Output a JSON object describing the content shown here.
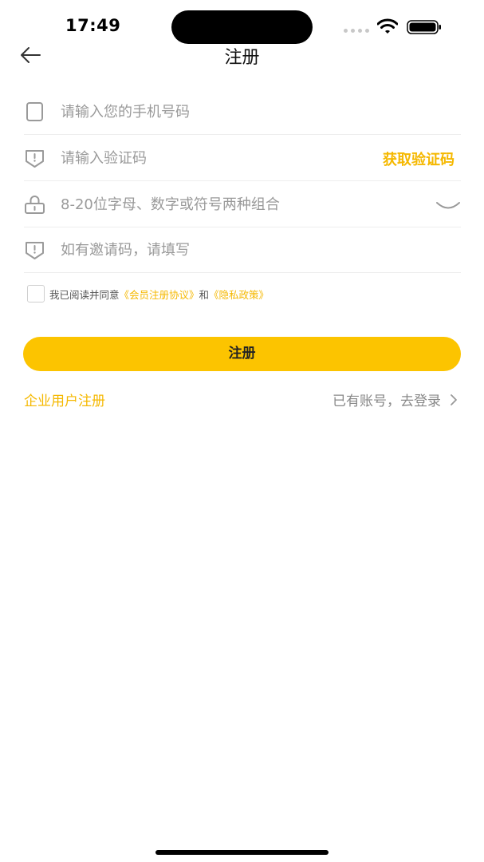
{
  "status_bar": {
    "time": "17:49"
  },
  "nav": {
    "title": "注册"
  },
  "form": {
    "phone_placeholder": "请输入您的手机号码",
    "code_placeholder": "请输入验证码",
    "get_code_label": "获取验证码",
    "password_placeholder": "8-20位字母、数字或符号两种组合",
    "invite_placeholder": "如有邀请码，请填写"
  },
  "agreement": {
    "prefix": "我已阅读并同意",
    "user_agreement": "《会员注册协议》",
    "connector": "和",
    "privacy_policy": "《隐私政策》"
  },
  "register_button_label": "注册",
  "enterprise_register_label": "企业用户注册",
  "login_link_label": "已有账号，去登录",
  "colors": {
    "accent": "#fcc400",
    "accent_text": "#f5b800",
    "placeholder": "#9a9a9a"
  }
}
